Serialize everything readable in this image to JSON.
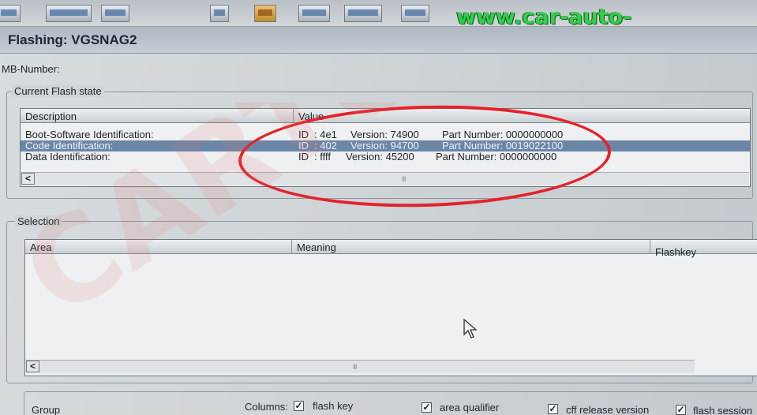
{
  "watermark": {
    "url": "www.car-auto-repair.com",
    "overlay_text": "CARTO",
    "url_color": "#2fd04a",
    "overlay_color": "#e4706e"
  },
  "window": {
    "title": "Flashing: VGSNAG2"
  },
  "mb_number": {
    "label": "MB-Number:"
  },
  "current_flash_state": {
    "legend": "Current Flash state",
    "columns": [
      "Description",
      "Value"
    ],
    "rows": [
      {
        "description": "Boot-Software Identification:",
        "id_label": "ID",
        "id": ": 4e1",
        "version": "Version: 74900",
        "part_number": "Part Number: 0000000000",
        "selected": false
      },
      {
        "description": "Code Identification:",
        "id_label": "ID",
        "id": ": 402",
        "version": "Version: 94700",
        "part_number": "Part Number: 0019022100",
        "selected": true
      },
      {
        "description": "Data Identification:",
        "id_label": "ID",
        "id": ": ffff",
        "version": "Version: 45200",
        "part_number": "Part Number: 0000000000",
        "selected": false
      }
    ],
    "scroll_left": "<",
    "scroll_grip": "III"
  },
  "selection": {
    "legend": "Selection",
    "columns": [
      "Area",
      "Meaning",
      "Flashkey"
    ],
    "scroll_left": "<",
    "scroll_grip": "III"
  },
  "footer": {
    "group_label": "Group",
    "columns_label": "Columns:",
    "options": [
      {
        "label": "flash key",
        "checked": true
      },
      {
        "label": "area qualifier",
        "checked": true
      },
      {
        "label": "cff release version",
        "checked": true
      },
      {
        "label": "flash session",
        "checked": true
      }
    ],
    "check_glyph": "✓"
  },
  "highlight_color": "#e5222b"
}
